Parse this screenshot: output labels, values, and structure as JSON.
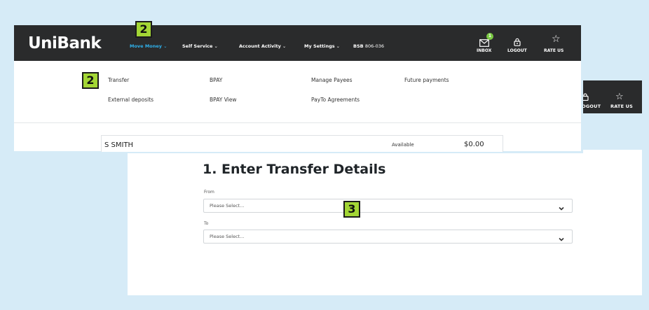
{
  "back_page": {
    "nav": {
      "logout_label": "LOGOUT",
      "rate_label": "RATE US"
    },
    "heading": "1. Enter Transfer Details",
    "from": {
      "label": "From",
      "placeholder": "Please Select..."
    },
    "to": {
      "label": "To",
      "placeholder": "Please Select..."
    }
  },
  "overlay": {
    "logo": "UniBank",
    "nav": {
      "move_money": "Move Money",
      "self_service": "Self Service",
      "account_activity": "Account Activity",
      "my_settings": "My Settings",
      "bsb_label": "BSB",
      "bsb_value": "806-036",
      "inbox_label": "INBOX",
      "logout_label": "LOGOUT",
      "rate_label": "RATE US",
      "inbox_count": "1"
    },
    "menu": {
      "transfer": "Transfer",
      "bpay": "BPAY",
      "manage_payees": "Manage Payees",
      "future_payments": "Future payments",
      "external_deposits": "External deposits",
      "bpay_view": "BPAY View",
      "payto_agreements": "PayTo Agreements"
    },
    "account": {
      "name": "S SMITH",
      "available_label": "Available",
      "balance": "$0.00"
    }
  },
  "badges": {
    "badge_nav": "2",
    "badge_transfer": "2",
    "badge_from": "3"
  },
  "colors": {
    "nav_bg": "#2a2b2c",
    "accent_blue": "#2fb0ea",
    "badge_green": "#a3d635",
    "inbox_green": "#7ac943"
  }
}
